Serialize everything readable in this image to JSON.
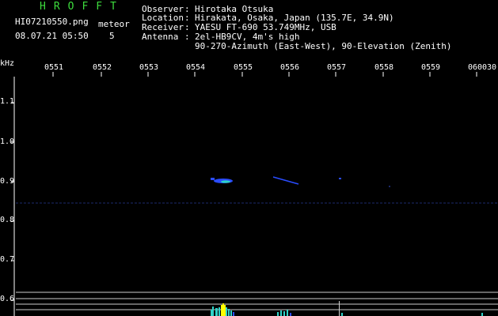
{
  "app": {
    "brand": "HROFFT",
    "filename": "HI07210550.png",
    "date_time": "08.07.21 05:50",
    "meteor_label": "meteor",
    "meteor_count": "5"
  },
  "header": {
    "observer_label": "Observer",
    "observer_value": "Hirotaka Otsuka",
    "location_label": "Location",
    "location_value": "Hirakata, Osaka, Japan (135.7E, 34.9N)",
    "receiver_label": "Receiver",
    "receiver_value": "YAESU FT-690 53.749MHz, USB",
    "antenna_label": "Antenna",
    "antenna_value": "2el-HB9CV, 4m's high",
    "antenna_value2": "90-270-Azimuth (East-West), 90-Elevation (Zenith)",
    "separator": ":"
  },
  "chart_data": {
    "type": "spectrogram",
    "ylabel": "kHz",
    "x_ticks": [
      "0551",
      "0552",
      "0553",
      "0554",
      "0555",
      "0556",
      "0557",
      "0558",
      "0559",
      "0600",
      "30"
    ],
    "y_ticks": [
      "1.1",
      "1.0",
      "0.9",
      "0.8",
      "0.7",
      "0.6"
    ],
    "colors": {
      "brand": "#3ddc3d",
      "text": "#ffffff",
      "grid": "#ffffff",
      "echo_core": "#2dd3c8",
      "echo_edge": "#2a4cff",
      "echo_yellow": "#ffff00",
      "noise_line": "#1b2a6b"
    }
  }
}
